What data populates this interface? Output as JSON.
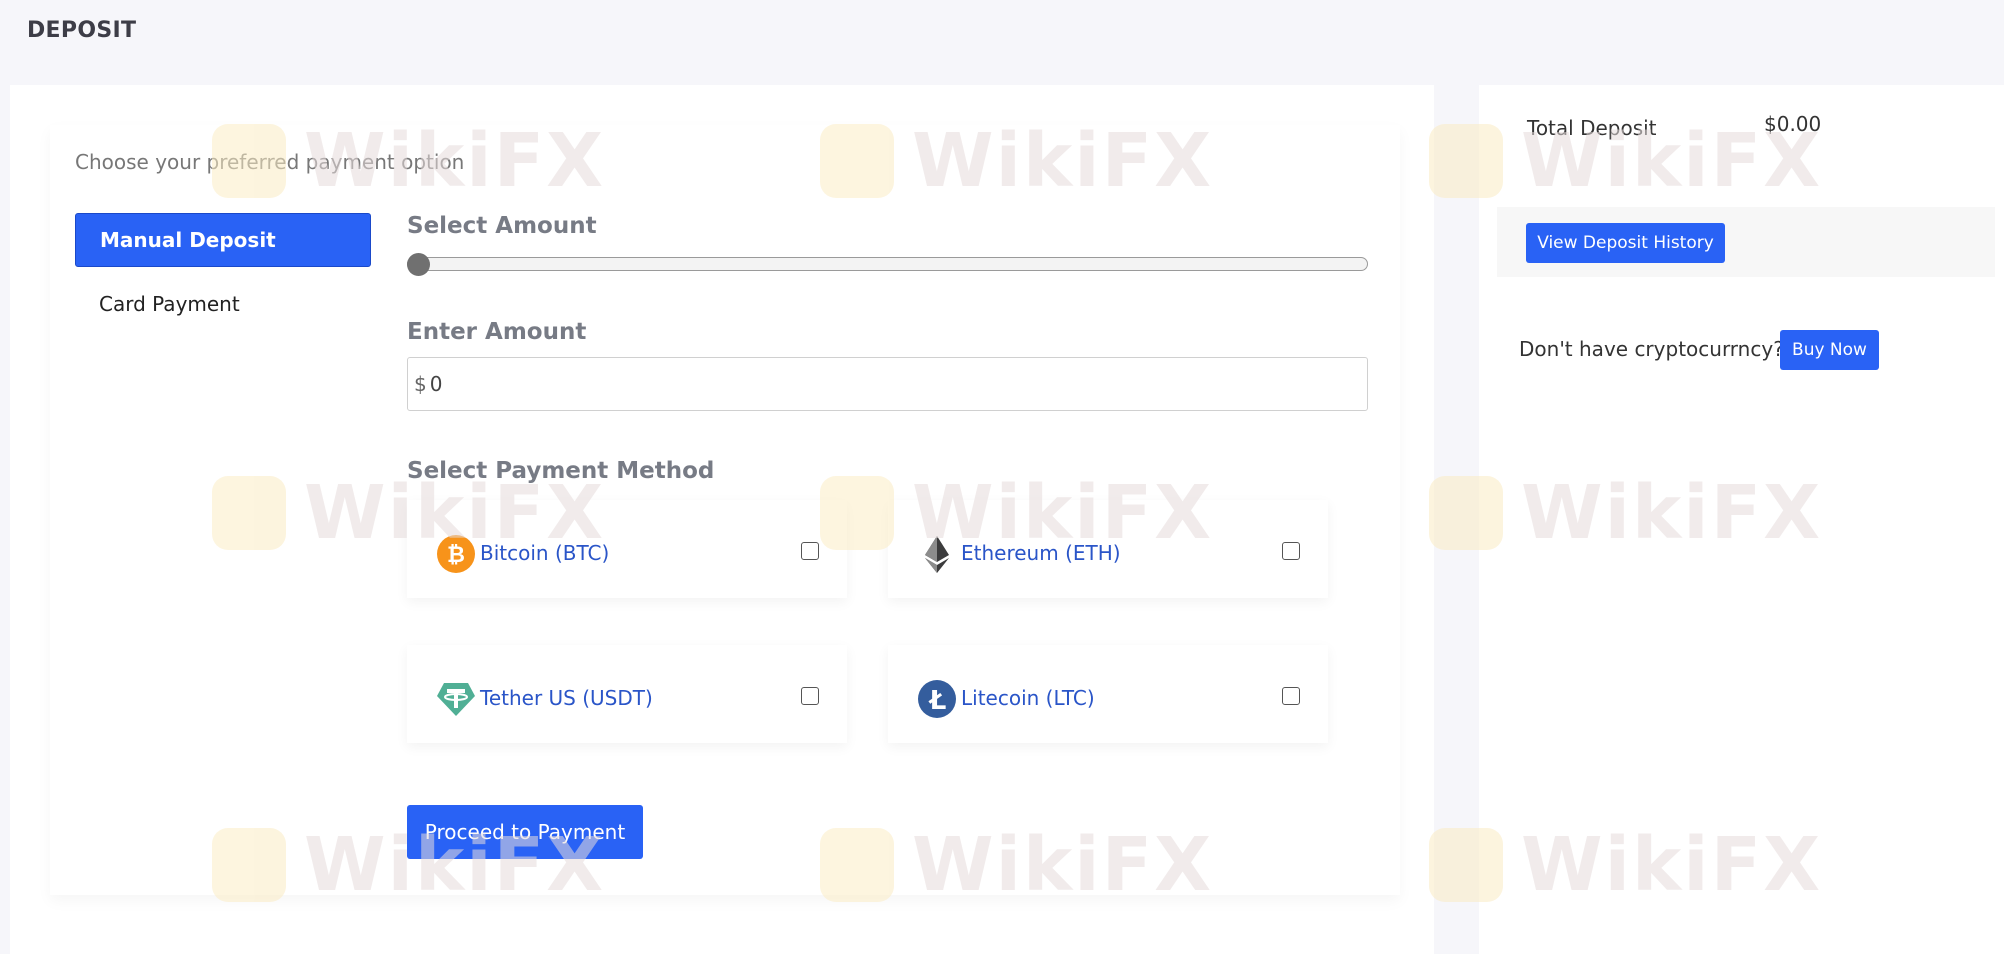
{
  "header": {
    "title": "DEPOSIT"
  },
  "main": {
    "subtitle": "Choose your preferred payment option",
    "nav": [
      {
        "label": "Manual Deposit",
        "active": true
      },
      {
        "label": "Card Payment",
        "active": false
      }
    ],
    "select_amount_label": "Select Amount",
    "slider": {
      "value": 0
    },
    "enter_amount_label": "Enter Amount",
    "amount_input": {
      "currency_symbol": "$",
      "value": "0"
    },
    "payment_method_label": "Select Payment Method",
    "methods": [
      {
        "label": "Bitcoin (BTC)",
        "icon": "bitcoin-icon",
        "color": "#f7931a",
        "checked": false
      },
      {
        "label": "Ethereum (ETH)",
        "icon": "ethereum-icon",
        "color": "#3c3c3d",
        "checked": false
      },
      {
        "label": "Tether US (USDT)",
        "icon": "tether-icon",
        "color": "#50af95",
        "checked": false
      },
      {
        "label": "Litecoin (LTC)",
        "icon": "litecoin-icon",
        "color": "#345d9d",
        "checked": false
      }
    ],
    "proceed_label": "Proceed to Payment"
  },
  "sidebar": {
    "total_label": "Total Deposit",
    "total_value": "$0.00",
    "history_label": "View Deposit History",
    "crypto_prompt": "Don't have cryptocurrncy?",
    "buy_label": "Buy Now"
  },
  "watermark": {
    "text": "WikiFX"
  },
  "colors": {
    "primary": "#2962f5",
    "link": "#2a55c8"
  }
}
